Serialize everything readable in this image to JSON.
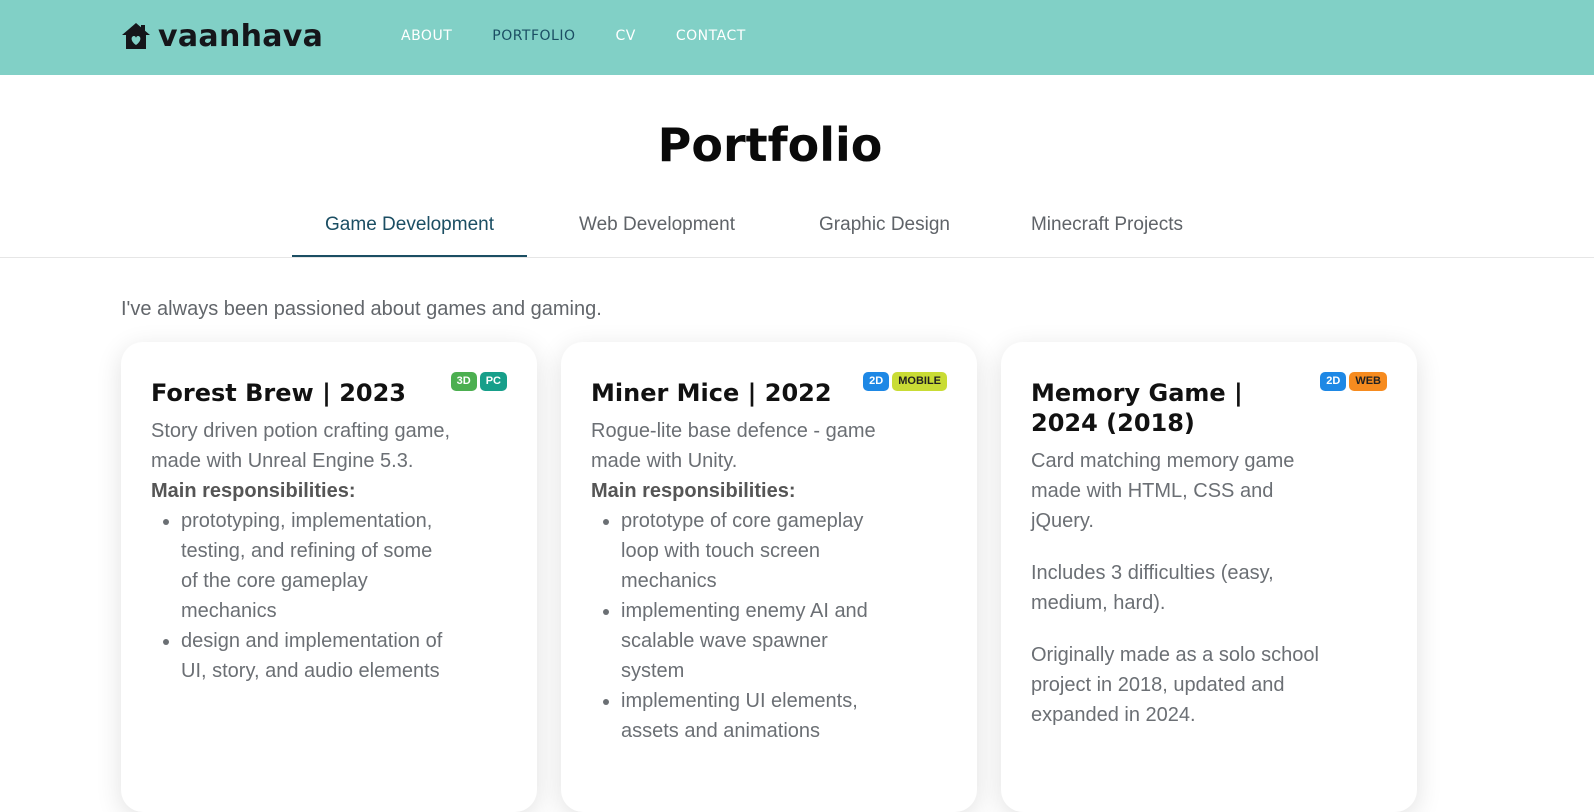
{
  "header": {
    "logo_text": "vaanhava",
    "nav": [
      "ABOUT",
      "PORTFOLIO",
      "CV",
      "CONTACT"
    ]
  },
  "page": {
    "title": "Portfolio",
    "tabs": [
      "Game Development",
      "Web Development",
      "Graphic Design",
      "Minecraft Projects"
    ],
    "intro": "I've always been passioned about games and gaming."
  },
  "cards": [
    {
      "title": "Forest Brew | 2023",
      "badges": [
        {
          "label": "3D",
          "color": "#4caf50"
        },
        {
          "label": "PC",
          "color": "#179f8a"
        }
      ],
      "description": "Story driven potion crafting game, made with Unreal Engine 5.3.",
      "responsibilities_label": "Main responsibilities:",
      "responsibilities": [
        "prototyping, implementation, testing, and refining of some of the core gameplay mechanics",
        "design and implementation of UI, story, and audio elements"
      ]
    },
    {
      "title": "Miner Mice | 2022",
      "badges": [
        {
          "label": "2D",
          "color": "#1e88e5"
        },
        {
          "label": "MOBILE",
          "color": "#c9dc35"
        }
      ],
      "description": "Rogue-lite base defence - game made with Unity.",
      "responsibilities_label": "Main responsibilities:",
      "responsibilities": [
        "prototype of core gameplay loop with touch screen mechanics",
        "implementing enemy AI and scalable wave spawner system",
        "implementing UI elements, assets and animations"
      ]
    },
    {
      "title": "Memory Game | 2024 (2018)",
      "badges": [
        {
          "label": "2D",
          "color": "#1e88e5"
        },
        {
          "label": "WEB",
          "color": "#f68b1f"
        }
      ],
      "paragraphs": [
        "Card matching memory game made with HTML, CSS and jQuery.",
        "Includes 3 difficulties (easy, medium, hard).",
        "Originally made as a solo school project in 2018, updated and expanded in 2024."
      ]
    }
  ],
  "colors": {
    "header_bg": "#81d0c6",
    "accent": "#1b4e63"
  }
}
